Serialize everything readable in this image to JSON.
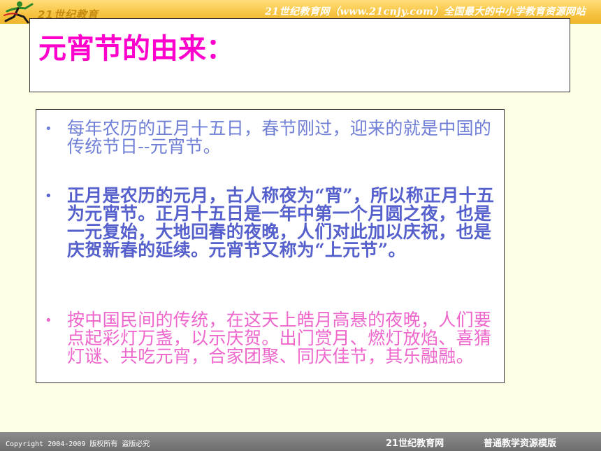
{
  "header": {
    "logo_text": "21世纪教育",
    "slogan": "21世纪教育网（www.21cnjy.com）全国最大的中小学教育资源网站"
  },
  "slide": {
    "title": "元宵节的由来：",
    "bullets": [
      {
        "text": "每年农历的正月十五日，春节刚过，迎来的就是中国的传统节日--元宵节。",
        "color": "#6f7fd6"
      },
      {
        "text": "正月是农历的元月，古人称夜为“宵”，所以称正月十五为元宵节。正月十五日是一年中第一个月圆之夜，也是一元复始，大地回春的夜晚，人们对此加以庆祝，也是庆贺新春的延续。元宵节又称为“上元节”。",
        "color": "#5560cc"
      },
      {
        "text": "按中国民间的传统，在这天上皓月高悬的夜晚，人们要点起彩灯万盏，以示庆贺。出门赏月、燃灯放焰、喜猜灯谜、共吃元宵，合家团聚、同庆佳节，其乐融融。",
        "color": "#ee66cc"
      }
    ]
  },
  "footer": {
    "copyright": "Copyright 2004-2009 版权所有 盗版必究",
    "site": "21世纪教育网",
    "template": "普通教学资源模版"
  },
  "colors": {
    "title": "#ff00cc",
    "header_band": "#f7c544",
    "footer_band": "#7a7a7a",
    "page_background": "#ffffe6"
  },
  "icons": {
    "logo": "running-figure-logo-icon"
  }
}
